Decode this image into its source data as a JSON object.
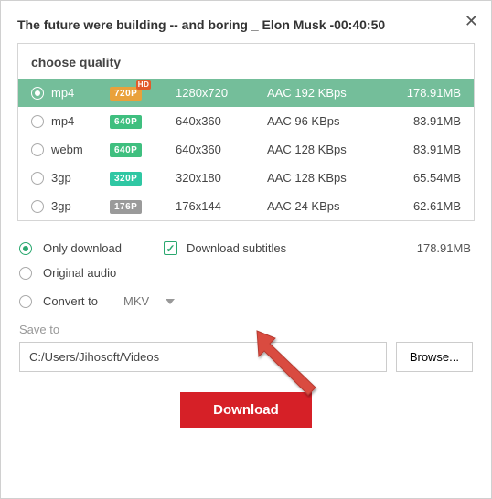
{
  "title": "The future were building -- and boring _ Elon Musk  -00:40:50",
  "close_glyph": "✕",
  "quality": {
    "header": "choose quality",
    "rows": [
      {
        "selected": true,
        "format": "mp4",
        "badge": "720P",
        "badge_color": "#e9a13b",
        "hd": "HD",
        "res": "1280x720",
        "audio": "AAC 192 KBps",
        "size": "178.91MB"
      },
      {
        "selected": false,
        "format": "mp4",
        "badge": "640P",
        "badge_color": "#3fbf7f",
        "hd": "",
        "res": "640x360",
        "audio": "AAC 96 KBps",
        "size": "83.91MB"
      },
      {
        "selected": false,
        "format": "webm",
        "badge": "640P",
        "badge_color": "#3fbf7f",
        "hd": "",
        "res": "640x360",
        "audio": "AAC 128 KBps",
        "size": "83.91MB"
      },
      {
        "selected": false,
        "format": "3gp",
        "badge": "320P",
        "badge_color": "#2fc7a3",
        "hd": "",
        "res": "320x180",
        "audio": "AAC 128 KBps",
        "size": "65.54MB"
      },
      {
        "selected": false,
        "format": "3gp",
        "badge": "176P",
        "badge_color": "#9a9a9a",
        "hd": "",
        "res": "176x144",
        "audio": "AAC 24 KBps",
        "size": "62.61MB"
      }
    ]
  },
  "options": {
    "only_download": "Only download",
    "download_subtitles": "Download subtitles",
    "original_audio": "Original audio",
    "convert_to": "Convert to",
    "convert_format": "MKV",
    "file_size": "178.91MB"
  },
  "save": {
    "label": "Save to",
    "path": "C:/Users/Jihosoft/Videos",
    "browse": "Browse..."
  },
  "download_label": "Download",
  "check_glyph": "✓"
}
